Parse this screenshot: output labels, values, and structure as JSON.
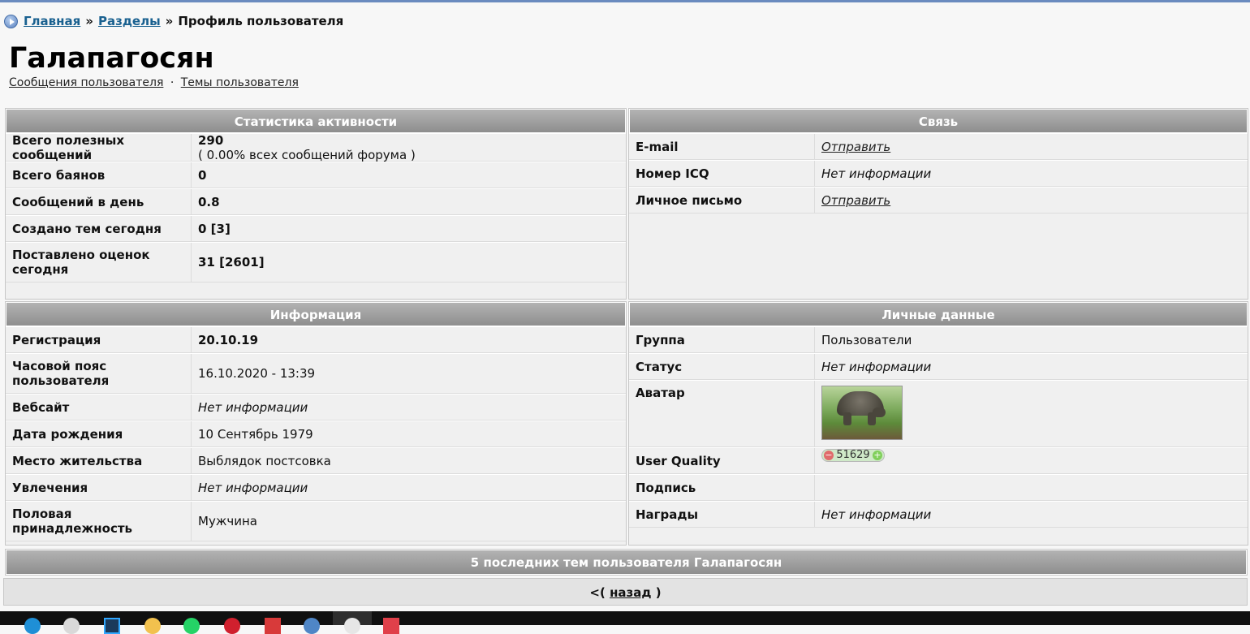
{
  "breadcrumb": {
    "home": "Главная",
    "sep1": "»",
    "sections": "Разделы",
    "sep2": "»",
    "current": "Профиль пользователя"
  },
  "page": {
    "title": "Галапагосян"
  },
  "sublinks": {
    "posts": "Сообщения пользователя",
    "dot": "·",
    "topics": "Темы пользователя"
  },
  "activity": {
    "title": "Статистика активности",
    "useful_label": "Всего полезных сообщений",
    "useful_value": "290",
    "useful_note": "( 0.00% всех сообщений форума )",
    "bayans_label": "Всего баянов",
    "bayans_value": "0",
    "perday_label": "Сообщений в день",
    "perday_value": "0.8",
    "topics_label": "Создано тем сегодня",
    "topics_value": "0 [3]",
    "ratings_label": "Поставлено оценок сегодня",
    "ratings_value": "31 [2601]"
  },
  "contact": {
    "title": "Связь",
    "email_label": "E-mail",
    "email_link": "Отправить",
    "icq_label": "Номер ICQ",
    "icq_value": "Нет информации",
    "pm_label": "Личное письмо",
    "pm_link": "Отправить"
  },
  "info": {
    "title": "Информация",
    "reg_label": "Регистрация",
    "reg_value": "20.10.19",
    "tz_label": "Часовой пояс пользователя",
    "tz_value": "16.10.2020 - 13:39",
    "web_label": "Вебсайт",
    "web_value": "Нет информации",
    "birth_label": "Дата рождения",
    "birth_value": "10 Сентябрь 1979",
    "place_label": "Место жительства",
    "place_value": "Выблядок постсовка",
    "hobby_label": "Увлечения",
    "hobby_value": "Нет информации",
    "gender_label": "Половая принадлежность",
    "gender_value": "Мужчина"
  },
  "personal": {
    "title": "Личные данные",
    "group_label": "Группа",
    "group_value": "Пользователи",
    "status_label": "Статус",
    "status_value": "Нет информации",
    "avatar_label": "Аватар",
    "uq_label": "User Quality",
    "uq_minus": "−",
    "uq_value": "51629",
    "uq_plus": "+",
    "sig_label": "Подпись",
    "awards_label": "Награды",
    "awards_value": "Нет информации"
  },
  "recent": {
    "title": "5 последних тем пользователя Галапагосян"
  },
  "back": {
    "prefix": "<(",
    "link": "назад",
    "suffix": ")"
  },
  "colors": {
    "accent": "#1a6190",
    "header_gray": "#8e8e8e",
    "panel_bg": "#f0f0f0"
  }
}
